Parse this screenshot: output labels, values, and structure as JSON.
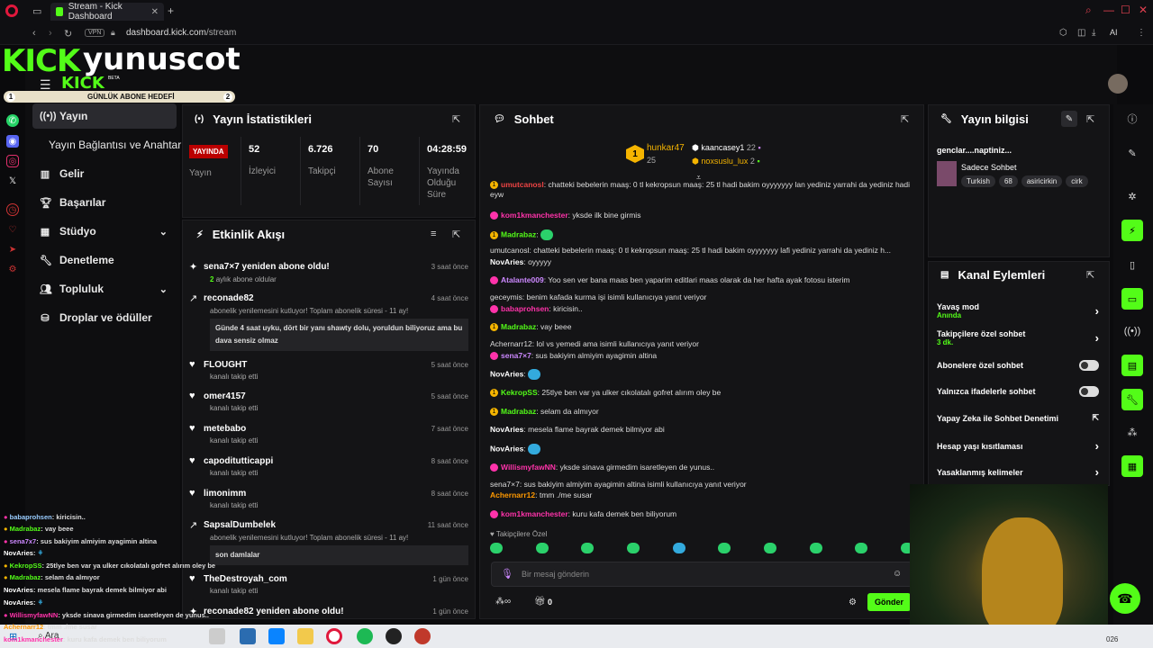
{
  "browser": {
    "tab_title": "Stream - Kick Dashboard",
    "vpn": "VPN",
    "url_host": "dashboard.kick.com",
    "url_path": "/stream",
    "ai_label": "AI"
  },
  "header": {
    "logo": "KICK",
    "channel": "yunuscot",
    "logo_small": "KICK",
    "beta": "BETA",
    "goal_label": "GÜNLÜK ABONE HEDEFİ",
    "goal_left": "1",
    "goal_right": "2"
  },
  "nav": {
    "items": [
      {
        "label": "Yayın",
        "icon": "broadcast-icon"
      },
      {
        "label": "Yayın Bağlantısı ve Anahtarı",
        "icon": ""
      },
      {
        "label": "Gelir",
        "icon": "chart-icon"
      },
      {
        "label": "Başarılar",
        "icon": "trophy-icon"
      },
      {
        "label": "Stüdyo",
        "icon": "studio-icon"
      },
      {
        "label": "Denetleme",
        "icon": "wrench-icon"
      },
      {
        "label": "Topluluk",
        "icon": "community-icon"
      },
      {
        "label": "Droplar ve ödüller",
        "icon": "drops-icon"
      }
    ]
  },
  "stats": {
    "title": "Yayın İstatistikleri",
    "live_badge": "YAYINDA",
    "live_label": "Yayın",
    "viewers_value": "52",
    "viewers_label": "İzleyici",
    "followers_value": "6.726",
    "followers_label": "Takipçi",
    "subs_value": "70",
    "subs_label": "Abone Sayısı",
    "uptime_value": "04:28:59",
    "uptime_label": "Yayında Olduğu Süre"
  },
  "activity": {
    "title": "Etkinlik Akışı",
    "items": [
      {
        "name": "sena7×7 yeniden abone oldu!",
        "time": "3 saat önce"
      },
      {
        "name": "reconade82",
        "time": "4 saat önce",
        "sub": "abonelik yenilemesini kutluyor! Toplam abonelik süresi - 11 ay!",
        "msg": "Günde 4 saat uyku, dört bir yanı shawty dolu, yoruldun biliyoruz ama bu dava sensiz olmaz"
      },
      {
        "name": "FLOUGHT",
        "time": "5 saat önce",
        "sub": "kanalı takip etti"
      },
      {
        "name": "omer4157",
        "time": "5 saat önce",
        "sub": "kanalı takip etti"
      },
      {
        "name": "metebabo",
        "time": "7 saat önce",
        "sub": "kanalı takip etti"
      },
      {
        "name": "capoditutticappi",
        "time": "8 saat önce",
        "sub": "kanalı takip etti"
      },
      {
        "name": "limonimm",
        "time": "8 saat önce",
        "sub": "kanalı takip etti"
      },
      {
        "name": "SapsalDumbelek",
        "time": "11 saat önce",
        "sub": "abonelik yenilemesini kutluyor! Toplam abonelik süresi - 11 ay!",
        "msg": "son damlalar"
      },
      {
        "name": "TheDestroyah_com",
        "time": "1 gün önce",
        "sub": "kanalı takip etti"
      },
      {
        "name": "reconade82 yeniden abone oldu!",
        "time": "1 gün önce"
      }
    ],
    "sub_2months": "2",
    "sub_2months_text": "aylık abone oldular"
  },
  "chat": {
    "title": "Sohbet",
    "top": [
      {
        "rank": "1",
        "name": "hunkar47",
        "count": "25"
      },
      {
        "name": "kaancasey1",
        "count": "22"
      },
      {
        "name": "noxsuslu_lux",
        "count": "2"
      }
    ],
    "messages": [
      {
        "user": "umutcanosl",
        "text": "chatteki bebelerin maaş: 0 tl kekropsun maaş: 25 tl hadi bakim oyyyyyyy lan yediniz yarrahi da yediniz hadi eyw",
        "color": "#e44"
      },
      {
        "user": "kom1kmanchester",
        "text": "yksde ilk bine girmis",
        "color": "#f3a"
      },
      {
        "user": "Madrabaz",
        "text": "",
        "color": "#53fc18"
      },
      {
        "reply": "umutcanosl: chatteki bebelerin maaş: 0 tl kekropsun maaş: 25 tl hadi bakim oyyyyyyy lafi yediniz yarrahi da yediniz h..."
      },
      {
        "user": "NovAries",
        "text": "oyyyyy",
        "color": "#fff"
      },
      {
        "user": "Atalante009",
        "text": "Yoo sen ver bana maas ben yaparim editlari maas olarak da her hafta ayak fotosu isterim",
        "color": "#c8f"
      },
      {
        "reply": "geceymis: benim kafada kurma işi isimli kullanıcıya yanıt veriyor"
      },
      {
        "user": "babaprohsen",
        "text": "kiricisin..",
        "color": "#f3a"
      },
      {
        "user": "Madrabaz",
        "text": "vay beee",
        "color": "#53fc18"
      },
      {
        "reply": "Achernarr12: lol vs yemedi ama isimli kullanıcıya yanıt veriyor"
      },
      {
        "user": "sena7×7",
        "text": "sus bakiyim almiyim ayagimin altina",
        "color": "#c8f"
      },
      {
        "user": "NovAries",
        "text": "",
        "color": "#fff"
      },
      {
        "user": "KekropSS",
        "text": "25tlye ben var ya ulker cıkolatalı gofret alırım oley be",
        "color": "#53fc18"
      },
      {
        "user": "Madrabaz",
        "text": "selam da almıyor",
        "color": "#53fc18"
      },
      {
        "user": "NovAries",
        "text": "mesela flame bayrak demek bilmiyor abi",
        "color": "#fff"
      },
      {
        "user": "NovAries",
        "text": "",
        "color": "#fff"
      },
      {
        "user": "WillismyfawNN",
        "text": "yksde sinava girmedim isaretleyen de yunus..",
        "color": "#f3a"
      },
      {
        "reply": "sena7×7: sus bakiyim almiyim ayagimin altina isimli kullanıcıya yanıt veriyor"
      },
      {
        "user": "Achernarr12",
        "text": "tmm ./me susar",
        "color": "#f90"
      },
      {
        "user": "kom1kmanchester",
        "text": "kuru kafa demek ben biliyorum",
        "color": "#f3a"
      }
    ],
    "followers_only": "Takipçilere Özel",
    "input_placeholder": "Bir mesaj gönderin",
    "points": "0",
    "send_label": "Gönder"
  },
  "stream_info": {
    "title": "Yayın bilgisi",
    "stream_title": "genclar....naptiniz...",
    "category": "Sadece Sohbet",
    "tags": [
      "Turkish",
      "68",
      "asiricirkin",
      "cirk"
    ]
  },
  "channel_actions": {
    "title": "Kanal Eylemleri",
    "items": [
      {
        "label": "Yavaş mod",
        "sub": "Anında"
      },
      {
        "label": "Takipçilere özel sohbet",
        "sub": "3 dk."
      },
      {
        "label": "Abonelere özel sohbet"
      },
      {
        "label": "Yalnızca ifadelerle sohbet"
      },
      {
        "label": "Yapay Zeka ile Sohbet Denetimi"
      },
      {
        "label": "Hesap yaşı kısıtlaması"
      },
      {
        "label": "Yasaklanmış kelimeler"
      }
    ]
  },
  "overlay_chat": [
    {
      "user": "babaprohsen",
      "text": "kiricisin.."
    },
    {
      "user": "Madrabaz",
      "text": "vay beee"
    },
    {
      "user": "sena7x7",
      "text": "sus bakiyim almiyim ayagimin altina"
    },
    {
      "user": "NovAries",
      "text": ""
    },
    {
      "user": "KekropSS",
      "text": "25tlye ben var ya ulker cıkolatalı gofret alırım oley be"
    },
    {
      "user": "Madrabaz",
      "text": "selam da almıyor"
    },
    {
      "user": "NovAries",
      "text": "mesela flame bayrak demek bilmiyor abi"
    },
    {
      "user": "NovAries",
      "text": ""
    },
    {
      "user": "WillismyfawNN",
      "text": "yksde sinava girmedim isaretleyen de yunus.."
    },
    {
      "user": "Achernarr12",
      "text": "tmm ./me susar"
    },
    {
      "user": "kom1kmanchester",
      "text": "kuru kafa demek ben biliyorum"
    }
  ],
  "taskbar": {
    "search": "Ara",
    "time_partial": "026"
  }
}
